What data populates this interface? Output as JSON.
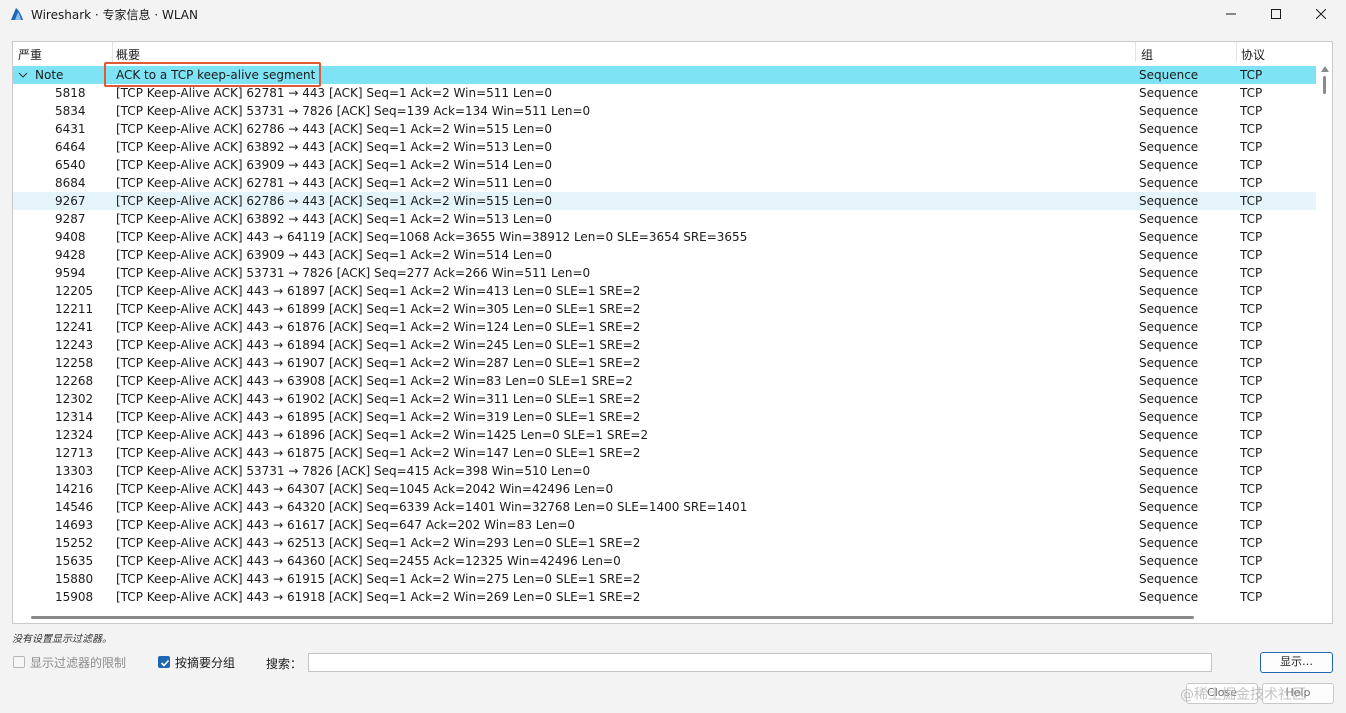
{
  "window": {
    "title": "Wireshark · 专家信息 · WLAN",
    "icon": "wireshark-fin-icon",
    "accent": "#1f67b3"
  },
  "table": {
    "headers": {
      "severity": "严重",
      "summary": "概要",
      "group": "组",
      "protocol": "协议"
    },
    "note_row": {
      "severity": "Note",
      "summary": "ACK to a TCP keep-alive segment",
      "group": "Sequence",
      "protocol": "TCP",
      "highlight_color": "#7ee3f5",
      "annotation_box_color": "#e05a36"
    },
    "rows": [
      {
        "num": "5818",
        "summary": "[TCP Keep-Alive ACK] 62781 → 443 [ACK] Seq=1 Ack=2 Win=511 Len=0",
        "group": "Sequence",
        "protocol": "TCP"
      },
      {
        "num": "5834",
        "summary": "[TCP Keep-Alive ACK] 53731 → 7826 [ACK] Seq=139 Ack=134 Win=511 Len=0",
        "group": "Sequence",
        "protocol": "TCP"
      },
      {
        "num": "6431",
        "summary": "[TCP Keep-Alive ACK] 62786 → 443 [ACK] Seq=1 Ack=2 Win=515 Len=0",
        "group": "Sequence",
        "protocol": "TCP"
      },
      {
        "num": "6464",
        "summary": "[TCP Keep-Alive ACK] 63892 → 443 [ACK] Seq=1 Ack=2 Win=513 Len=0",
        "group": "Sequence",
        "protocol": "TCP"
      },
      {
        "num": "6540",
        "summary": "[TCP Keep-Alive ACK] 63909 → 443 [ACK] Seq=1 Ack=2 Win=514 Len=0",
        "group": "Sequence",
        "protocol": "TCP"
      },
      {
        "num": "8684",
        "summary": "[TCP Keep-Alive ACK] 62781 → 443 [ACK] Seq=1 Ack=2 Win=511 Len=0",
        "group": "Sequence",
        "protocol": "TCP"
      },
      {
        "num": "9267",
        "summary": "[TCP Keep-Alive ACK] 62786 → 443 [ACK] Seq=1 Ack=2 Win=515 Len=0",
        "group": "Sequence",
        "protocol": "TCP",
        "selected": true
      },
      {
        "num": "9287",
        "summary": "[TCP Keep-Alive ACK] 63892 → 443 [ACK] Seq=1 Ack=2 Win=513 Len=0",
        "group": "Sequence",
        "protocol": "TCP"
      },
      {
        "num": "9408",
        "summary": "[TCP Keep-Alive ACK] 443 → 64119 [ACK] Seq=1068 Ack=3655 Win=38912 Len=0 SLE=3654 SRE=3655",
        "group": "Sequence",
        "protocol": "TCP"
      },
      {
        "num": "9428",
        "summary": "[TCP Keep-Alive ACK] 63909 → 443 [ACK] Seq=1 Ack=2 Win=514 Len=0",
        "group": "Sequence",
        "protocol": "TCP"
      },
      {
        "num": "9594",
        "summary": "[TCP Keep-Alive ACK] 53731 → 7826 [ACK] Seq=277 Ack=266 Win=511 Len=0",
        "group": "Sequence",
        "protocol": "TCP"
      },
      {
        "num": "12205",
        "summary": "[TCP Keep-Alive ACK] 443 → 61897 [ACK] Seq=1 Ack=2 Win=413 Len=0 SLE=1 SRE=2",
        "group": "Sequence",
        "protocol": "TCP"
      },
      {
        "num": "12211",
        "summary": "[TCP Keep-Alive ACK] 443 → 61899 [ACK] Seq=1 Ack=2 Win=305 Len=0 SLE=1 SRE=2",
        "group": "Sequence",
        "protocol": "TCP"
      },
      {
        "num": "12241",
        "summary": "[TCP Keep-Alive ACK] 443 → 61876 [ACK] Seq=1 Ack=2 Win=124 Len=0 SLE=1 SRE=2",
        "group": "Sequence",
        "protocol": "TCP"
      },
      {
        "num": "12243",
        "summary": "[TCP Keep-Alive ACK] 443 → 61894 [ACK] Seq=1 Ack=2 Win=245 Len=0 SLE=1 SRE=2",
        "group": "Sequence",
        "protocol": "TCP"
      },
      {
        "num": "12258",
        "summary": "[TCP Keep-Alive ACK] 443 → 61907 [ACK] Seq=1 Ack=2 Win=287 Len=0 SLE=1 SRE=2",
        "group": "Sequence",
        "protocol": "TCP"
      },
      {
        "num": "12268",
        "summary": "[TCP Keep-Alive ACK] 443 → 63908 [ACK] Seq=1 Ack=2 Win=83 Len=0 SLE=1 SRE=2",
        "group": "Sequence",
        "protocol": "TCP"
      },
      {
        "num": "12302",
        "summary": "[TCP Keep-Alive ACK] 443 → 61902 [ACK] Seq=1 Ack=2 Win=311 Len=0 SLE=1 SRE=2",
        "group": "Sequence",
        "protocol": "TCP"
      },
      {
        "num": "12314",
        "summary": "[TCP Keep-Alive ACK] 443 → 61895 [ACK] Seq=1 Ack=2 Win=319 Len=0 SLE=1 SRE=2",
        "group": "Sequence",
        "protocol": "TCP"
      },
      {
        "num": "12324",
        "summary": "[TCP Keep-Alive ACK] 443 → 61896 [ACK] Seq=1 Ack=2 Win=1425 Len=0 SLE=1 SRE=2",
        "group": "Sequence",
        "protocol": "TCP"
      },
      {
        "num": "12713",
        "summary": "[TCP Keep-Alive ACK] 443 → 61875 [ACK] Seq=1 Ack=2 Win=147 Len=0 SLE=1 SRE=2",
        "group": "Sequence",
        "protocol": "TCP"
      },
      {
        "num": "13303",
        "summary": "[TCP Keep-Alive ACK] 53731 → 7826 [ACK] Seq=415 Ack=398 Win=510 Len=0",
        "group": "Sequence",
        "protocol": "TCP"
      },
      {
        "num": "14216",
        "summary": "[TCP Keep-Alive ACK] 443 → 64307 [ACK] Seq=1045 Ack=2042 Win=42496 Len=0",
        "group": "Sequence",
        "protocol": "TCP"
      },
      {
        "num": "14546",
        "summary": "[TCP Keep-Alive ACK] 443 → 64320 [ACK] Seq=6339 Ack=1401 Win=32768 Len=0 SLE=1400 SRE=1401",
        "group": "Sequence",
        "protocol": "TCP"
      },
      {
        "num": "14693",
        "summary": "[TCP Keep-Alive ACK] 443 → 61617 [ACK] Seq=647 Ack=202 Win=83 Len=0",
        "group": "Sequence",
        "protocol": "TCP"
      },
      {
        "num": "15252",
        "summary": "[TCP Keep-Alive ACK] 443 → 62513 [ACK] Seq=1 Ack=2 Win=293 Len=0 SLE=1 SRE=2",
        "group": "Sequence",
        "protocol": "TCP"
      },
      {
        "num": "15635",
        "summary": "[TCP Keep-Alive ACK] 443 → 64360 [ACK] Seq=2455 Ack=12325 Win=42496 Len=0",
        "group": "Sequence",
        "protocol": "TCP"
      },
      {
        "num": "15880",
        "summary": "[TCP Keep-Alive ACK] 443 → 61915 [ACK] Seq=1 Ack=2 Win=275 Len=0 SLE=1 SRE=2",
        "group": "Sequence",
        "protocol": "TCP"
      },
      {
        "num": "15908",
        "summary": "[TCP Keep-Alive ACK] 443 → 61918 [ACK] Seq=1 Ack=2 Win=269 Len=0 SLE=1 SRE=2",
        "group": "Sequence",
        "protocol": "TCP"
      }
    ]
  },
  "footer": {
    "filter_status": "没有设置显示过滤器。",
    "limit_to_filter_label": "显示过滤器的限制",
    "limit_to_filter_checked": false,
    "group_by_summary_label": "按摘要分组",
    "group_by_summary_checked": true,
    "search_label": "搜索：",
    "search_value": "",
    "show_button": "显示…",
    "close_button": "Close",
    "help_button": "Help",
    "watermark": "@稀土掘金技术社区"
  }
}
